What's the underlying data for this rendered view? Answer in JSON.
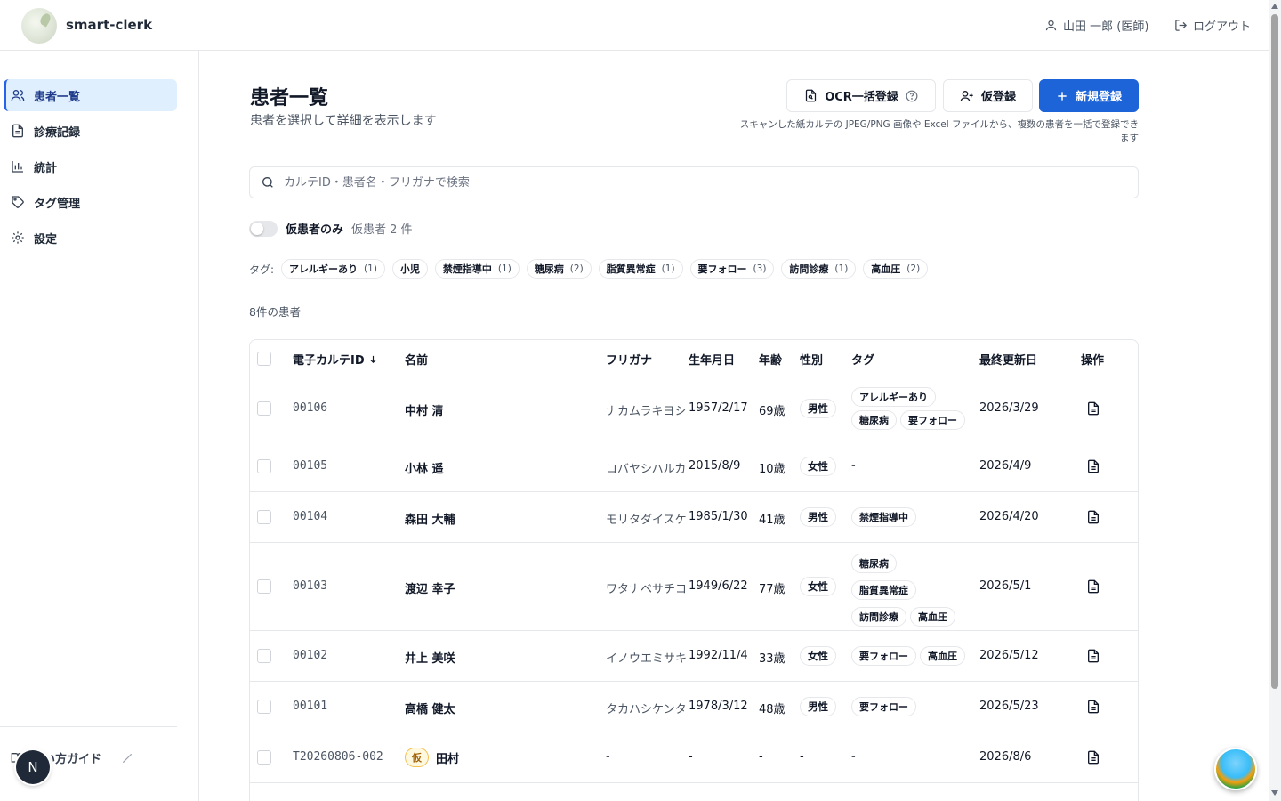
{
  "header": {
    "brand": "smart-clerk",
    "user": "山田 一郎 (医師)",
    "logout": "ログアウト"
  },
  "sidebar": {
    "items": [
      {
        "label": "患者一覧",
        "icon": "users-icon",
        "active": true
      },
      {
        "label": "診療記録",
        "icon": "file-text-icon",
        "active": false
      },
      {
        "label": "統計",
        "icon": "bar-chart-icon",
        "active": false
      },
      {
        "label": "タグ管理",
        "icon": "tag-icon",
        "active": false
      },
      {
        "label": "設定",
        "icon": "gear-icon",
        "active": false
      }
    ],
    "guide": "使い方ガイド",
    "avatar_initial": "N"
  },
  "page": {
    "title": "患者一覧",
    "subtitle": "患者を選択して詳細を表示します",
    "ocr_button": "OCR一括登録",
    "provisional_button": "仮登録",
    "new_button": "新規登録",
    "hint": "スキャンした紙カルテの JPEG/PNG 画像や Excel ファイルから、複数の患者を一括で登録できます"
  },
  "search": {
    "placeholder": "カルテID・患者名・フリガナで検索",
    "value": ""
  },
  "filter": {
    "toggle_label": "仮患者のみ",
    "toggle_count": "仮患者 2 件",
    "toggle_on": false
  },
  "tags": {
    "label": "タグ:",
    "items": [
      {
        "name": "アレルギーあり",
        "count": "(1)"
      },
      {
        "name": "小児",
        "count": ""
      },
      {
        "name": "禁煙指導中",
        "count": "(1)"
      },
      {
        "name": "糖尿病",
        "count": "(2)"
      },
      {
        "name": "脂質異常症",
        "count": "(1)"
      },
      {
        "name": "要フォロー",
        "count": "(3)"
      },
      {
        "name": "訪問診療",
        "count": "(1)"
      },
      {
        "name": "高血圧",
        "count": "(2)"
      }
    ]
  },
  "result_count": "8件の患者",
  "table": {
    "headers": {
      "id": "電子カルテID",
      "name": "名前",
      "kana": "フリガナ",
      "birth": "生年月日",
      "age": "年齢",
      "gender": "性別",
      "tags": "タグ",
      "updated": "最終更新日",
      "actions": "操作"
    },
    "rows": [
      {
        "id": "00106",
        "name": "中村 清",
        "kana": "ナカムラキヨシ",
        "birth": "1957/2/17",
        "age": "69歳",
        "gender": "男性",
        "tags": [
          "アレルギーあり",
          "糖尿病",
          "要フォロー"
        ],
        "updated": "2026/3/29"
      },
      {
        "id": "00105",
        "name": "小林 遥",
        "kana": "コバヤシハルカ",
        "birth": "2015/8/9",
        "age": "10歳",
        "gender": "女性",
        "tags_text": "-",
        "tags": [],
        "updated": "2026/4/9"
      },
      {
        "id": "00104",
        "name": "森田 大輔",
        "kana": "モリタダイスケ",
        "birth": "1985/1/30",
        "age": "41歳",
        "gender": "男性",
        "tags": [
          "禁煙指導中"
        ],
        "updated": "2026/4/20"
      },
      {
        "id": "00103",
        "name": "渡辺 幸子",
        "kana": "ワタナベサチコ",
        "birth": "1949/6/22",
        "age": "77歳",
        "gender": "女性",
        "tags": [
          "糖尿病",
          "脂質異常症",
          "訪問診療",
          "高血圧"
        ],
        "updated": "2026/5/1"
      },
      {
        "id": "00102",
        "name": "井上 美咲",
        "kana": "イノウエミサキ",
        "birth": "1992/11/4",
        "age": "33歳",
        "gender": "女性",
        "tags": [
          "要フォロー",
          "高血圧"
        ],
        "updated": "2026/5/12"
      },
      {
        "id": "00101",
        "name": "高橋 健太",
        "kana": "タカハシケンタ",
        "birth": "1978/3/12",
        "age": "48歳",
        "gender": "男性",
        "tags": [
          "要フォロー"
        ],
        "updated": "2026/5/23"
      },
      {
        "id": "T20260806-002",
        "provisional_badge": "仮",
        "name": "田村",
        "kana": "-",
        "birth": "-",
        "age": "-",
        "gender_text": "-",
        "tags_text": "-",
        "tags": [],
        "updated": "2026/8/6"
      }
    ]
  },
  "colors": {
    "primary": "#1d64d8",
    "active_nav_bg": "#e0effe",
    "border": "#e5e7eb",
    "provisional": "#f2c14e"
  }
}
